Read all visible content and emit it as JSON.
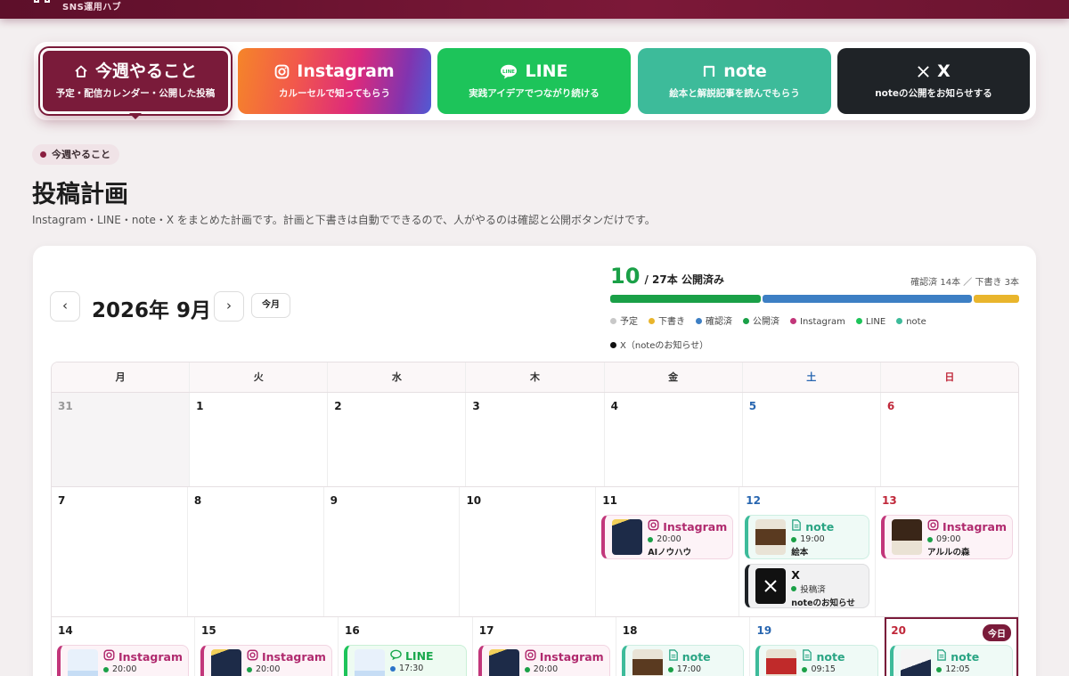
{
  "header": {
    "brand": "SNS運用ハブ"
  },
  "tabs": [
    {
      "title": "今週やること",
      "subtitle": "予定・配信カレンダー・公開した投稿",
      "icon": "home-icon",
      "active": true
    },
    {
      "title": "Instagram",
      "subtitle": "カルーセルで知ってもらう",
      "icon": "instagram-icon"
    },
    {
      "title": "LINE",
      "subtitle": "実践アイデアでつながり続ける",
      "icon": "line-icon"
    },
    {
      "title": "note",
      "subtitle": "絵本と解説記事を読んでもらう",
      "icon": "note-icon"
    },
    {
      "title": "X",
      "subtitle": "noteの公開をお知らせする",
      "icon": "x-icon"
    }
  ],
  "page": {
    "pill": "今週やること",
    "title": "投稿計画",
    "description": "Instagram・LINE・note・X をまとめた計画です。計画と下書きは自動でできるので、人がやるのは確認と公開ボタンだけです。"
  },
  "calendar": {
    "month_label": "2026年 9月",
    "prev": "‹",
    "next": "›",
    "today_button": "今月",
    "published": "10",
    "published_suffix": "/ 27本 公開済み",
    "summary_right": "確認済 14本 ／ 下書き 3本",
    "progress": {
      "published": 10,
      "confirmed": 14,
      "draft": 3,
      "total": 27
    },
    "colors": {
      "scheduled": "#c8c8c8",
      "draft": "#e9b52c",
      "confirmed": "#3d7fc4",
      "published": "#1aa047",
      "instagram": "#c2367a",
      "line": "#1dc45a",
      "note": "#3dbb9a",
      "x": "#111111"
    },
    "legend": [
      {
        "label": "予定",
        "color": "#c8c8c8"
      },
      {
        "label": "下書き",
        "color": "#e9b52c"
      },
      {
        "label": "確認済",
        "color": "#3d7fc4"
      },
      {
        "label": "公開済",
        "color": "#1aa047"
      },
      {
        "label": "Instagram",
        "color": "#c2367a"
      },
      {
        "label": "LINE",
        "color": "#1dc45a"
      },
      {
        "label": "note",
        "color": "#3dbb9a"
      },
      {
        "label": "X（noteのお知らせ）",
        "color": "#111111"
      }
    ],
    "weekdays": [
      "月",
      "火",
      "水",
      "木",
      "金",
      "土",
      "日"
    ],
    "today_badge": "今日",
    "weeks": [
      [
        {
          "d": "31",
          "out": true
        },
        {
          "d": "1"
        },
        {
          "d": "2"
        },
        {
          "d": "3"
        },
        {
          "d": "4"
        },
        {
          "d": "5"
        },
        {
          "d": "6"
        }
      ],
      [
        {
          "d": "7"
        },
        {
          "d": "8"
        },
        {
          "d": "9"
        },
        {
          "d": "10"
        },
        {
          "d": "11",
          "events": [
            {
              "type": "ig",
              "platform": "Instagram",
              "time": "20:00",
              "title": "AIノウハウ",
              "thumb": "th-ig"
            }
          ]
        },
        {
          "d": "12",
          "events": [
            {
              "type": "note",
              "platform": "note",
              "time": "19:00",
              "title": "絵本",
              "thumb": "th-note"
            },
            {
              "type": "x",
              "platform": "X",
              "time": "投稿済",
              "title": "noteのお知らせ",
              "thumb": "th-x"
            }
          ]
        },
        {
          "d": "13",
          "events": [
            {
              "type": "ig",
              "platform": "Instagram",
              "time": "09:00",
              "title": "アルルの森",
              "thumb": "th-forest"
            }
          ]
        }
      ],
      [
        {
          "d": "14",
          "events": [
            {
              "type": "ig",
              "platform": "Instagram",
              "time": "20:00",
              "title": "",
              "thumb": "th-line"
            }
          ]
        },
        {
          "d": "15",
          "events": [
            {
              "type": "ig",
              "platform": "Instagram",
              "time": "20:00",
              "title": "",
              "thumb": "th-ig"
            }
          ]
        },
        {
          "d": "16",
          "events": [
            {
              "type": "line",
              "platform": "LINE",
              "time": "17:30",
              "title": "",
              "thumb": "th-line",
              "blue": true
            }
          ]
        },
        {
          "d": "17",
          "events": [
            {
              "type": "ig",
              "platform": "Instagram",
              "time": "20:00",
              "title": "",
              "thumb": "th-ig"
            }
          ]
        },
        {
          "d": "18",
          "events": [
            {
              "type": "note",
              "platform": "note",
              "time": "17:00",
              "title": "",
              "thumb": "th-note"
            }
          ]
        },
        {
          "d": "19",
          "events": [
            {
              "type": "note",
              "platform": "note",
              "time": "09:15",
              "title": "",
              "thumb": "th-red"
            }
          ]
        },
        {
          "d": "20",
          "today": true,
          "events": [
            {
              "type": "note",
              "platform": "note",
              "time": "12:05",
              "title": "",
              "thumb": "th-white"
            }
          ]
        }
      ]
    ]
  }
}
